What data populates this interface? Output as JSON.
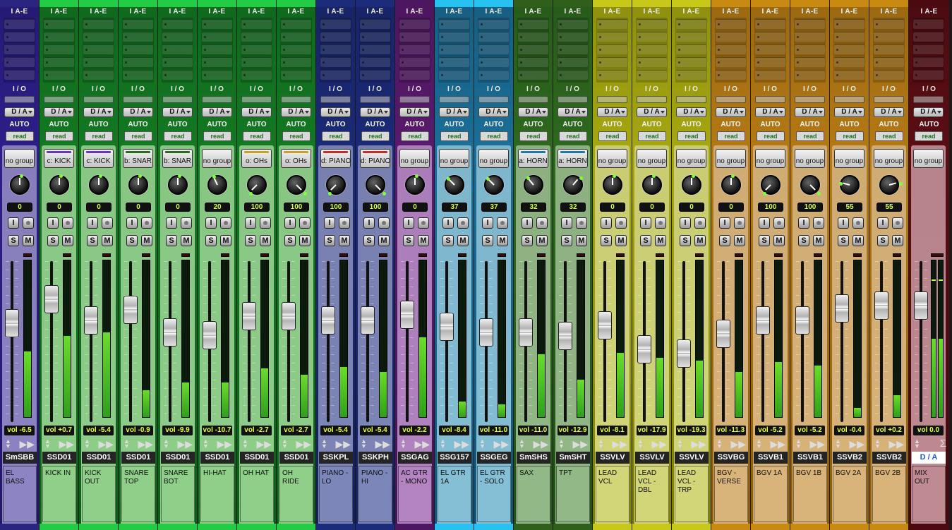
{
  "app": {
    "title": "Mix Window"
  },
  "labels": {
    "insert_header": "I A-E",
    "io_header": "I / O",
    "auto_label": "AUTO",
    "auto_mode": "read",
    "solo": "S",
    "mute": "M",
    "input_monitor": "I"
  },
  "channels": [
    {
      "name": "SmSBB",
      "comment": "EL BASS",
      "output": "D / A",
      "group": "no group",
      "pan": "0",
      "vol": "vol -6.5",
      "knob_deg": 0,
      "fader": 0.64,
      "meter": 0.42,
      "color": "#2c1f8a",
      "lower": "#8d84c4",
      "top": "#2b2580"
    },
    {
      "name": "SSD01",
      "comment": "KICK IN",
      "output": "D / A",
      "group": "c: KICK",
      "group_color": "#6a35b8",
      "pan": "0",
      "vol": "vol +0.7",
      "knob_deg": 0,
      "fader": 0.82,
      "meter": 0.52,
      "color": "#137a22",
      "lower": "#8fcf8a",
      "top": "#22cc44"
    },
    {
      "name": "SSD01",
      "comment": "KICK OUT",
      "output": "D / A",
      "group": "c: KICK",
      "group_color": "#6a35b8",
      "pan": "0",
      "vol": "vol -5.4",
      "knob_deg": 0,
      "fader": 0.66,
      "meter": 0.54,
      "color": "#137a22",
      "lower": "#8fcf8a",
      "top": "#22cc44"
    },
    {
      "name": "SSD01",
      "comment": "SNARE TOP",
      "output": "D / A",
      "group": "b: SNAR",
      "group_color": "#2b6a1e",
      "pan": "0",
      "vol": "vol -0.9",
      "knob_deg": 0,
      "fader": 0.74,
      "meter": 0.17,
      "color": "#137a22",
      "lower": "#8fcf8a",
      "top": "#22cc44"
    },
    {
      "name": "SSD01",
      "comment": "SNARE BOT",
      "output": "D / A",
      "group": "b: SNAR",
      "group_color": "#2b6a1e",
      "pan": "0",
      "vol": "vol -9.9",
      "knob_deg": 0,
      "fader": 0.57,
      "meter": 0.22,
      "color": "#137a22",
      "lower": "#8fcf8a",
      "top": "#22cc44"
    },
    {
      "name": "SSD01",
      "comment": "HI-HAT",
      "output": "D / A",
      "group": "no group",
      "pan": "20",
      "vol": "vol -10.7",
      "knob_deg": -25,
      "fader": 0.55,
      "meter": 0.22,
      "color": "#137a22",
      "lower": "#8fcf8a",
      "top": "#22cc44"
    },
    {
      "name": "SSD01",
      "comment": "OH HAT",
      "output": "D / A",
      "group": "o: OHs",
      "group_color": "#c9a12a",
      "pan": "100",
      "vol": "vol -2.7",
      "knob_deg": -135,
      "fader": 0.69,
      "meter": 0.31,
      "color": "#137a22",
      "lower": "#8fcf8a",
      "top": "#22cc44"
    },
    {
      "name": "SSD01",
      "comment": "OH RIDE",
      "output": "D / A",
      "group": "o: OHs",
      "group_color": "#c9a12a",
      "pan": "100",
      "vol": "vol -2.7",
      "knob_deg": 135,
      "fader": 0.69,
      "meter": 0.27,
      "color": "#137a22",
      "lower": "#8fcf8a",
      "top": "#22cc44"
    },
    {
      "name": "SSKPL",
      "comment": "PIANO - LO",
      "output": "D / A",
      "group": "d: PIANO",
      "group_color": "#c0302a",
      "pan": "100",
      "vol": "vol -5.4",
      "knob_deg": -135,
      "fader": 0.66,
      "meter": 0.32,
      "color": "#1b2a78",
      "lower": "#7d86b8",
      "top": "#1c2b7a"
    },
    {
      "name": "SSKPH",
      "comment": "PIANO - HI",
      "output": "D / A",
      "group": "d: PIANO",
      "group_color": "#c0302a",
      "pan": "100",
      "vol": "vol -5.4",
      "knob_deg": 135,
      "fader": 0.66,
      "meter": 0.29,
      "color": "#1b2a78",
      "lower": "#7d86b8",
      "top": "#1c2b7a"
    },
    {
      "name": "SSGAG",
      "comment": "AC GTR - MONO",
      "output": "D / A",
      "group": "no group",
      "pan": "0",
      "vol": "vol -2.2",
      "knob_deg": 0,
      "fader": 0.7,
      "meter": 0.51,
      "color": "#5a1a6e",
      "lower": "#b383c2",
      "top": "#4d1660"
    },
    {
      "name": "SSG157",
      "comment": "EL GTR 1A",
      "output": "D / A",
      "group": "no group",
      "pan": "37",
      "vol": "vol -8.4",
      "knob_deg": -45,
      "fader": 0.61,
      "meter": 0.1,
      "color": "#1b6f99",
      "lower": "#84bfd6",
      "top": "#28c2f2"
    },
    {
      "name": "SSGEG",
      "comment": "EL GTR - SOLO",
      "output": "D / A",
      "group": "no group",
      "pan": "37",
      "vol": "vol -11.0",
      "knob_deg": -45,
      "fader": 0.57,
      "meter": 0.08,
      "color": "#1b6f99",
      "lower": "#84bfd6",
      "top": "#28c2f2"
    },
    {
      "name": "SmSHS",
      "comment": "SAX",
      "output": "D / A",
      "group": "a: HORN",
      "group_color": "#1e77a8",
      "pan": "32",
      "vol": "vol -11.0",
      "knob_deg": -40,
      "fader": 0.57,
      "meter": 0.4,
      "color": "#2e6a1e",
      "lower": "#93b887",
      "top": "#2f5f1a"
    },
    {
      "name": "SmSHT",
      "comment": "TPT",
      "output": "D / A",
      "group": "a: HORN",
      "group_color": "#1e77a8",
      "pan": "32",
      "vol": "vol -12.9",
      "knob_deg": 40,
      "fader": 0.54,
      "meter": 0.24,
      "color": "#2e6a1e",
      "lower": "#93b887",
      "top": "#2f5f1a"
    },
    {
      "name": "SSVLV",
      "comment": "LEAD VCL",
      "output": "D / A",
      "group": "no group",
      "pan": "0",
      "vol": "vol -8.1",
      "knob_deg": 0,
      "fader": 0.62,
      "meter": 0.41,
      "color": "#a7a810",
      "lower": "#d3d678",
      "top": "#c8c81a"
    },
    {
      "name": "SSVLV",
      "comment": "LEAD VCL - DBL",
      "output": "D / A",
      "group": "no group",
      "pan": "0",
      "vol": "vol -17.9",
      "knob_deg": 0,
      "fader": 0.44,
      "meter": 0.38,
      "color": "#a7a810",
      "lower": "#d3d678",
      "top": "#c8c81a"
    },
    {
      "name": "SSVLV",
      "comment": "LEAD VCL - TRP",
      "output": "D / A",
      "group": "no group",
      "pan": "0",
      "vol": "vol -19.3",
      "knob_deg": 0,
      "fader": 0.41,
      "meter": 0.36,
      "color": "#a7a810",
      "lower": "#d3d678",
      "top": "#c8c81a"
    },
    {
      "name": "SSVBG",
      "comment": "BGV - VERSE",
      "output": "D / A",
      "group": "no group",
      "pan": "0",
      "vol": "vol -11.3",
      "knob_deg": 0,
      "fader": 0.56,
      "meter": 0.29,
      "color": "#b57a14",
      "lower": "#d9b47a",
      "top": "#c98a12"
    },
    {
      "name": "SSVB1",
      "comment": "BGV 1A",
      "output": "D / A",
      "group": "no group",
      "pan": "100",
      "vol": "vol -5.2",
      "knob_deg": -135,
      "fader": 0.66,
      "meter": 0.35,
      "color": "#b57a14",
      "lower": "#d9b47a",
      "top": "#c98a12"
    },
    {
      "name": "SSVB1",
      "comment": "BGV 1B",
      "output": "D / A",
      "group": "no group",
      "pan": "100",
      "vol": "vol -5.2",
      "knob_deg": 135,
      "fader": 0.66,
      "meter": 0.33,
      "color": "#b57a14",
      "lower": "#d9b47a",
      "top": "#c98a12"
    },
    {
      "name": "SSVB2",
      "comment": "BGV 2A",
      "output": "D / A",
      "group": "no group",
      "pan": "55",
      "vol": "vol -0.4",
      "knob_deg": -75,
      "fader": 0.75,
      "meter": 0.06,
      "color": "#b57a14",
      "lower": "#d9b47a",
      "top": "#c98a12"
    },
    {
      "name": "SSVB2",
      "comment": "BGV 2B",
      "output": "D / A",
      "group": "no group",
      "pan": "55",
      "vol": "vol +0.2",
      "knob_deg": 75,
      "fader": 0.77,
      "meter": 0.14,
      "color": "#b57a14",
      "lower": "#d9b47a",
      "top": "#c98a12"
    },
    {
      "name": "D / A",
      "comment": "MIX OUT",
      "output": "D / A",
      "group": "no group",
      "vol": "vol 0.0",
      "fader": 0.77,
      "meter": 0.5,
      "meter2": 0.5,
      "master": true,
      "color": "#5b0d14",
      "lower": "#c08a92",
      "top": "#4a0a10"
    }
  ]
}
